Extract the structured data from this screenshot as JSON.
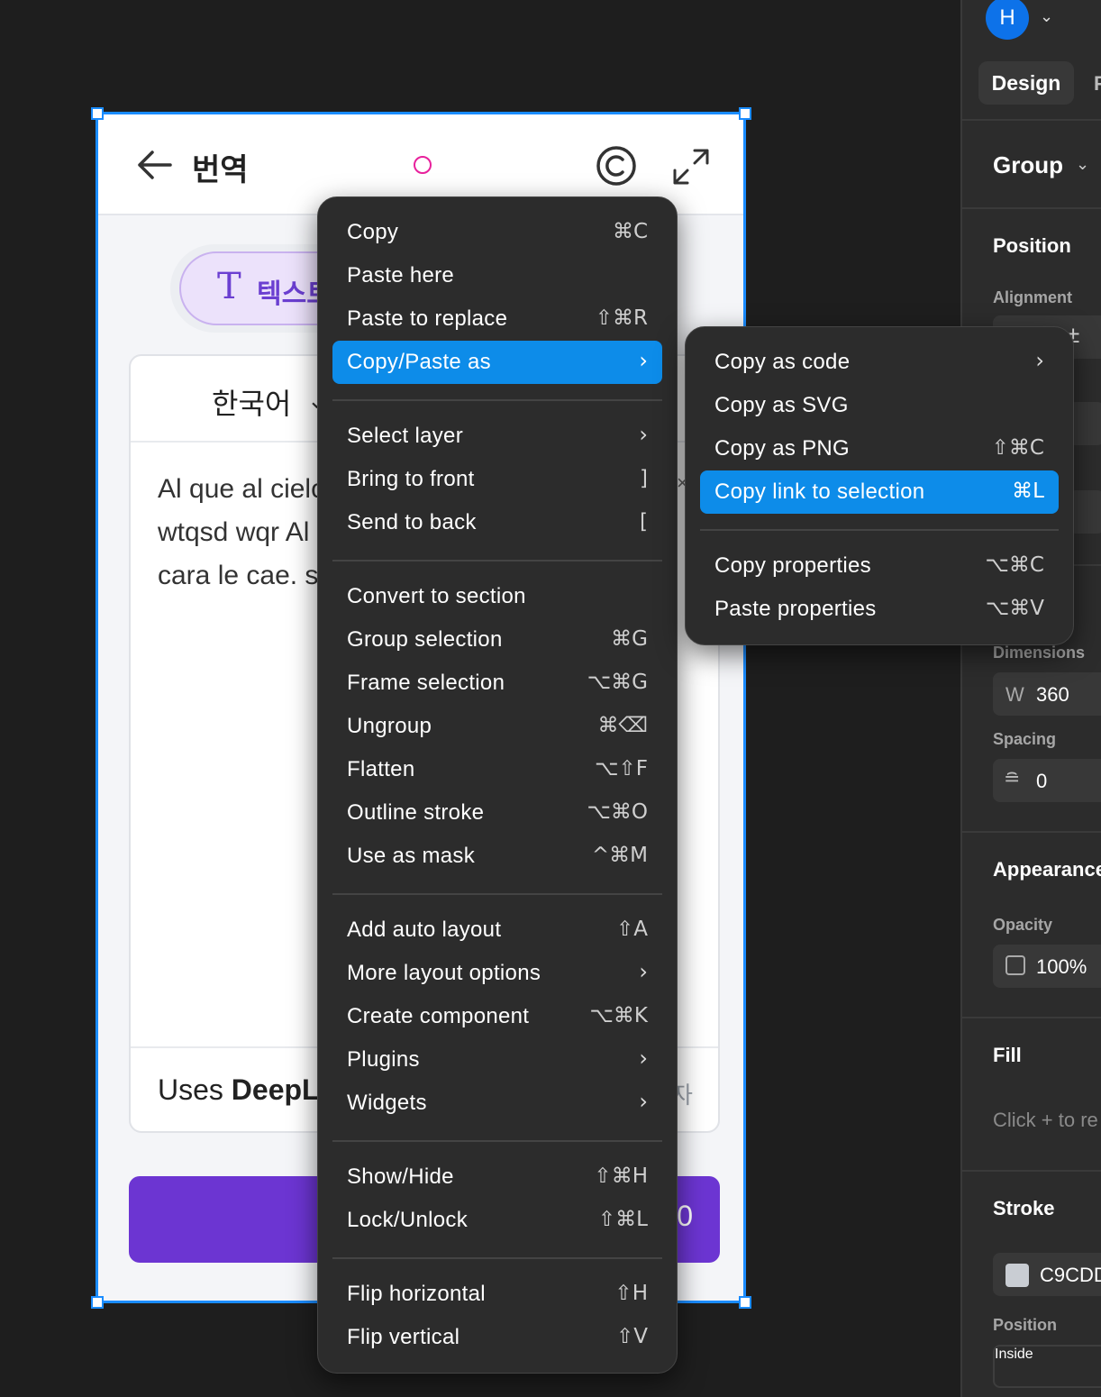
{
  "app": {
    "title": "번역",
    "mode_label": "텍스트",
    "mode_icon": "T",
    "source_language": "한국어",
    "source_text": "Al que al cielo escupe, en la cara le cae. wtqsd wqr Al que al cielo escupe, en la cara le cae. s",
    "source_text_visible": "Al que al cielo\nwtqsd wqr Al\ncara le cae. s",
    "footer_prefix": "Uses ",
    "footer_brand": "DeepL",
    "footer_right": "자",
    "button_tail": "0",
    "accent_color": "#6c35d2"
  },
  "main_menu": {
    "items": [
      {
        "label": "Copy",
        "shortcut": "⌘C"
      },
      {
        "label": "Paste here",
        "shortcut": ""
      },
      {
        "label": "Paste to replace",
        "shortcut": "⇧⌘R"
      },
      {
        "label": "Copy/Paste as",
        "shortcut": "",
        "submenu": true,
        "active": true
      },
      {
        "label": "Select layer",
        "shortcut": "",
        "submenu": true
      },
      {
        "label": "Bring to front",
        "shortcut": "]"
      },
      {
        "label": "Send to back",
        "shortcut": "["
      },
      {
        "label": "Convert to section",
        "shortcut": ""
      },
      {
        "label": "Group selection",
        "shortcut": "⌘G"
      },
      {
        "label": "Frame selection",
        "shortcut": "⌥⌘G"
      },
      {
        "label": "Ungroup",
        "shortcut": "⌘⌫"
      },
      {
        "label": "Flatten",
        "shortcut": "⌥⇧F"
      },
      {
        "label": "Outline stroke",
        "shortcut": "⌥⌘O"
      },
      {
        "label": "Use as mask",
        "shortcut": "^⌘M"
      },
      {
        "label": "Add auto layout",
        "shortcut": "⇧A"
      },
      {
        "label": "More layout options",
        "shortcut": "",
        "submenu": true
      },
      {
        "label": "Create component",
        "shortcut": "⌥⌘K"
      },
      {
        "label": "Plugins",
        "shortcut": "",
        "submenu": true
      },
      {
        "label": "Widgets",
        "shortcut": "",
        "submenu": true
      },
      {
        "label": "Show/Hide",
        "shortcut": "⇧⌘H"
      },
      {
        "label": "Lock/Unlock",
        "shortcut": "⇧⌘L"
      },
      {
        "label": "Flip horizontal",
        "shortcut": "⇧H"
      },
      {
        "label": "Flip vertical",
        "shortcut": "⇧V"
      }
    ]
  },
  "sub_menu": {
    "items": [
      {
        "label": "Copy as code",
        "shortcut": "",
        "submenu": true
      },
      {
        "label": "Copy as SVG",
        "shortcut": ""
      },
      {
        "label": "Copy as PNG",
        "shortcut": "⇧⌘C"
      },
      {
        "label": "Copy link to selection",
        "shortcut": "⌘L",
        "active": true
      },
      {
        "label": "Copy properties",
        "shortcut": "⌥⌘C"
      },
      {
        "label": "Paste properties",
        "shortcut": "⌥⌘V"
      }
    ]
  },
  "panel": {
    "avatar_initial": "H",
    "tab_design": "Design",
    "tab_prototype_stub": "P",
    "layer_type": "Group",
    "position_heading": "Position",
    "alignment_label": "Alignment",
    "dimensions_label": "Dimensions",
    "width_label": "W",
    "width_value": "360",
    "spacing_label": "Spacing",
    "spacing_value": "0",
    "appearance_heading": "Appearance",
    "opacity_label": "Opacity",
    "opacity_value": "100%",
    "fill_heading": "Fill",
    "fill_hint": "Click + to re",
    "stroke_heading": "Stroke",
    "stroke_color": "C9CDD",
    "stroke_position_label": "Position",
    "stroke_position_value": "Inside"
  }
}
